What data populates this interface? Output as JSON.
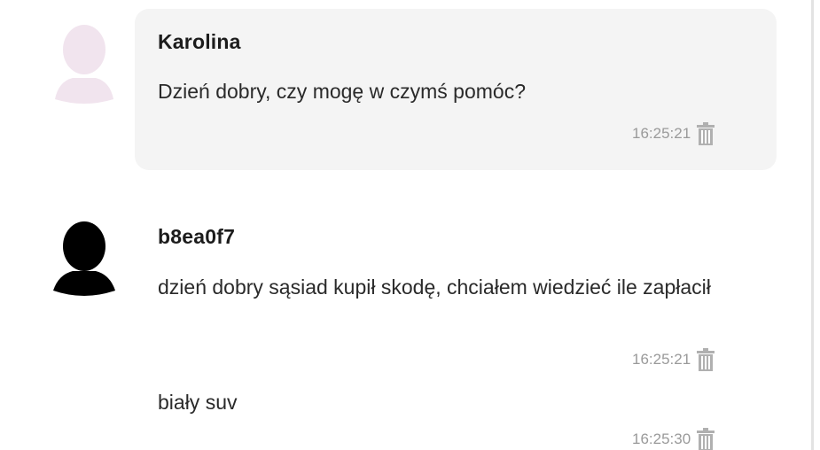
{
  "conversation": {
    "agent": {
      "name": "Karolina",
      "messages": [
        {
          "text": "Dzień dobry, czy mogę w czymś pomóc?",
          "time": "16:25:21"
        }
      ]
    },
    "visitor": {
      "name": "b8ea0f7",
      "messages": [
        {
          "text": "dzień dobry sąsiad kupił skodę, chciałem wiedzieć ile zapłacił",
          "time": "16:25:21"
        },
        {
          "text": "biały suv",
          "time": "16:25:30"
        }
      ]
    }
  },
  "icons": {
    "agent_avatar": "user-silhouette-icon",
    "visitor_avatar": "user-silhouette-icon",
    "delete": "trash-icon"
  },
  "colors": {
    "agent_bubble": "#f4f4f4",
    "agent_avatar": "#f1e4ee",
    "visitor_avatar": "#000000",
    "timestamp": "#9a9a9a"
  }
}
